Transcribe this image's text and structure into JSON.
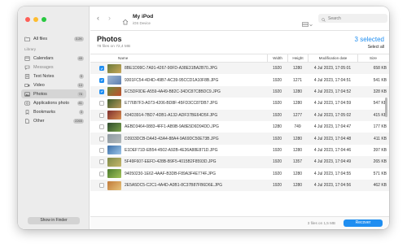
{
  "sidebar": {
    "all_files": {
      "label": "All files",
      "count": "3.2K"
    },
    "library_label": "Library",
    "items": [
      {
        "label": "Calendars",
        "count": "49",
        "icon": "calendar-icon"
      },
      {
        "label": "Messages",
        "count": "",
        "icon": "messages-icon"
      },
      {
        "label": "Text Notes",
        "count": "5",
        "icon": "notes-icon"
      },
      {
        "label": "Video",
        "count": "14",
        "icon": "video-icon"
      },
      {
        "label": "Photos",
        "count": "78",
        "icon": "photos-icon"
      },
      {
        "label": "Applications photo",
        "count": "81",
        "icon": "app-photo-icon"
      },
      {
        "label": "Bookmarks",
        "count": "3",
        "icon": "bookmark-icon"
      },
      {
        "label": "Other",
        "count": "2265",
        "icon": "other-icon"
      }
    ],
    "show_in_finder": "Show in Finder"
  },
  "toolbar": {
    "device_name": "My iPod",
    "device_type": "iOS Device",
    "search_placeholder": "Search"
  },
  "header": {
    "title": "Photos",
    "subtitle": "78 files on 72,4 MB",
    "selected": "3 selected",
    "select_all": "Select all"
  },
  "table": {
    "columns": {
      "name": "Name",
      "width": "Width",
      "height": "Height",
      "date": "Modification date",
      "size": "Size"
    },
    "rows": [
      {
        "name": "8BE1D99C-7A91-4267-90FD-A38E31BA2B70.JPG",
        "width": "1920",
        "height": "1280",
        "date": "4 Jul 2023, 17:05:01",
        "size": "658 KB",
        "checked": true
      },
      {
        "name": "9301FC54-4D4D-49B7-AC39-95CCD1A10F8B.JPG",
        "width": "1920",
        "height": "1271",
        "date": "4 Jul 2023, 17:04:51",
        "size": "541 KB",
        "checked": true
      },
      {
        "name": "EC5DF0DE-A559-4A49-B82C-34DC87C8BDC9.JPG",
        "width": "1920",
        "height": "1280",
        "date": "4 Jul 2023, 17:04:52",
        "size": "328 KB",
        "checked": true
      },
      {
        "name": "E776B7F3-A073-4206-BD8F-45FD3CC87DB7.JPG",
        "width": "1920",
        "height": "1280",
        "date": "4 Jul 2023, 17:04:59",
        "size": "547 KB",
        "checked": false
      },
      {
        "name": "434D3914-7BD7-4DB1-A132-ADF37BE64D5F.JPG",
        "width": "1920",
        "height": "1277",
        "date": "4 Jul 2023, 17:05:02",
        "size": "415 KB",
        "checked": false
      },
      {
        "name": "AEBD3464-0883-4FF1-AB9B-9A8E5D6D94DD.JPG",
        "width": "1280",
        "height": "749",
        "date": "4 Jul 2023, 17:04:47",
        "size": "177 KB",
        "checked": false
      },
      {
        "name": "D3933DCB-DA43-43A4-88A4-9A69DC50E73B.JPG",
        "width": "1920",
        "height": "1280",
        "date": "4 Jul 2023, 17:04:48",
        "size": "411 KB",
        "checked": false
      },
      {
        "name": "E1DEF71D-EB54-4502-A92B-4E36A88E871D.JPG",
        "width": "1920",
        "height": "1280",
        "date": "4 Jul 2023, 17:04:46",
        "size": "397 KB",
        "checked": false
      },
      {
        "name": "5F49F607-EEFD-428B-B9F5-4015B2F8593D.JPG",
        "width": "1920",
        "height": "1357",
        "date": "4 Jul 2023, 17:04:49",
        "size": "265 KB",
        "checked": false
      },
      {
        "name": "94050230-1E62-4AAF-B3DB-F89A3F4E774F.JPG",
        "width": "1920",
        "height": "1280",
        "date": "4 Jul 2023, 17:04:55",
        "size": "571 KB",
        "checked": false
      },
      {
        "name": "2E5A5DC5-C2C1-4A4D-A0B1-8C37B87FB6D6E.JPG",
        "width": "1920",
        "height": "1280",
        "date": "4 Jul 2023, 17:04:56",
        "size": "462 KB",
        "checked": false
      }
    ]
  },
  "footer": {
    "info": "3 files on 1,5 MB",
    "recover": "Recover"
  },
  "colors": {
    "accent": "#1f8ef1"
  }
}
